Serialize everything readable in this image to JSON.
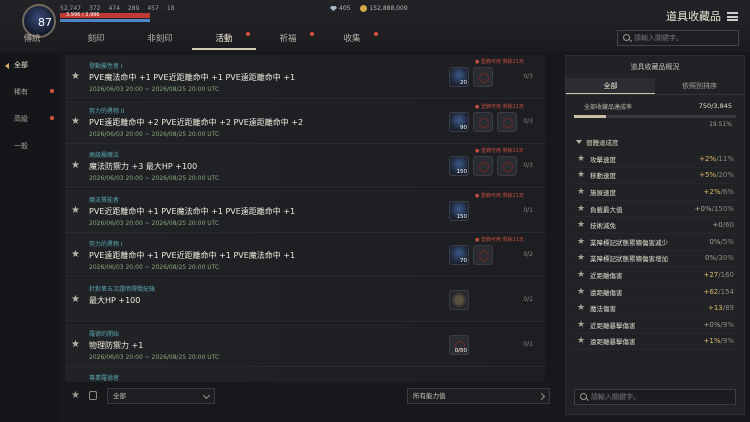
{
  "player": {
    "level": "87",
    "stats": [
      "52,747",
      "372",
      "474",
      "289",
      "457",
      "18"
    ],
    "hp_text": "3,996 / 3,996",
    "hp_fraction": 1.0,
    "mp_fraction": 1.0
  },
  "currency": {
    "gems": "405",
    "coins": "152,888,009"
  },
  "page_title": "道具收藏品",
  "tabs": [
    {
      "label": "傳統",
      "dot": false,
      "active": false
    },
    {
      "label": "刻印",
      "dot": false,
      "active": false
    },
    {
      "label": "非刻印",
      "dot": false,
      "active": false
    },
    {
      "label": "活動",
      "dot": true,
      "active": true
    },
    {
      "label": "祈福",
      "dot": true,
      "active": false
    },
    {
      "label": "收集",
      "dot": true,
      "active": false
    }
  ],
  "top_search": {
    "placeholder": "請輸入關鍵字。"
  },
  "sidebar": {
    "items": [
      {
        "label": "全部",
        "active": true,
        "dot": false
      },
      {
        "label": "稀有",
        "active": false,
        "dot": true
      },
      {
        "label": "高級",
        "active": false,
        "dot": true
      },
      {
        "label": "一般",
        "active": false,
        "dot": false
      }
    ]
  },
  "cards": [
    {
      "category": "發動屬性者 I",
      "title": "PVE魔法命中 +1  PVE近距離命中 +1  PVE遠距離命中 +1",
      "date": "2026/06/03 20:00 ~ 2026/08/25 20:00 UTC",
      "warn": "● 登錄可用 剩餘21天",
      "slots": [
        {
          "type": "filled",
          "n": "20"
        },
        {
          "type": "empty",
          "n": ""
        }
      ],
      "progress": "0/3"
    },
    {
      "category": "努力的勇物 II",
      "title": "PVE遠距離命中 +2  PVE近距離命中 +2  PVE遠距離命中 +2",
      "date": "2026/06/03 20:00 ~ 2026/08/25 20:00 UTC",
      "warn": "● 登錄可用 剩餘21天",
      "slots": [
        {
          "type": "filled",
          "n": "90"
        },
        {
          "type": "empty",
          "n": ""
        },
        {
          "type": "empty",
          "n": ""
        }
      ],
      "progress": "0/3"
    },
    {
      "category": "高級屬魔法",
      "title": "魔法防禦力 +3  最大HP +100",
      "date": "2026/06/03 20:00 ~ 2026/08/25 20:00 UTC",
      "warn": "● 登錄可用 剩餘21天",
      "slots": [
        {
          "type": "filled",
          "n": "150"
        },
        {
          "type": "empty",
          "n": ""
        },
        {
          "type": "empty",
          "n": ""
        }
      ],
      "progress": "0/3"
    },
    {
      "category": "魔法賢能者",
      "title": "PVE近距離命中 +1  PVE魔法命中 +1  PVE遠距離命中 +1",
      "date": "2026/06/03 20:00 ~ 2026/08/25 20:00 UTC",
      "warn": "● 登錄可用 剩餘21天",
      "slots": [
        {
          "type": "filled",
          "n": "150"
        }
      ],
      "progress": "0/1"
    },
    {
      "category": "努力的勇物 I",
      "title": "PVE遠距離命中 +1  PVE近距離命中 +1  PVE魔法命中 +1",
      "date": "2026/06/03 20:00 ~ 2026/08/25 20:00 UTC",
      "warn": "● 登錄可用 剩餘21天",
      "slots": [
        {
          "type": "filled",
          "n": "70"
        },
        {
          "type": "empty",
          "n": ""
        }
      ],
      "progress": "0/2"
    },
    {
      "category": "針對第五次證明得獎紀錄",
      "title": "最大HP +100",
      "date": "",
      "warn": "",
      "slots": [
        {
          "type": "ring",
          "n": ""
        }
      ],
      "progress": "0/1"
    },
    {
      "category": "羅德的開始",
      "title": "物理防禦力 +1",
      "date": "2026/06/03 20:00 ~ 2026/08/25 20:00 UTC",
      "warn": "",
      "slots": [
        {
          "type": "empty",
          "n": "0/50"
        }
      ],
      "progress": "0/1"
    },
    {
      "category": "專業羅德者",
      "title": "",
      "date": "",
      "warn": "",
      "slots": [],
      "progress": ""
    }
  ],
  "bottom": {
    "filter_label": "全部",
    "power_label": "所有能力值"
  },
  "panel": {
    "title": "道具收藏品概況",
    "tabs": [
      {
        "label": "全部",
        "active": true
      },
      {
        "label": "依照別排序",
        "active": false
      }
    ],
    "rate_label": "全部收藏品達成率",
    "rate_value": "750/3,845",
    "rate_fraction": 0.1951,
    "rate_percent": "19.51%",
    "section_label": "個體達成度",
    "stats": [
      {
        "name": "攻擊速度",
        "cur": "+2%",
        "max": "/11%",
        "zero": false
      },
      {
        "name": "移動速度",
        "cur": "+5%",
        "max": "/20%",
        "zero": false
      },
      {
        "name": "施展速度",
        "cur": "+2%",
        "max": "/6%",
        "zero": false
      },
      {
        "name": "負載最大值",
        "cur": "+0%",
        "max": "/150%",
        "zero": true
      },
      {
        "name": "技術減免",
        "cur": "+0",
        "max": "/60",
        "zero": true
      },
      {
        "name": "業障標記狀態累積傷害減少",
        "cur": "0%",
        "max": "/5%",
        "zero": true
      },
      {
        "name": "業障標記狀態累積傷害增加",
        "cur": "0%",
        "max": "/30%",
        "zero": true
      },
      {
        "name": "近距離傷害",
        "cur": "+27",
        "max": "/160",
        "zero": false
      },
      {
        "name": "遠距離傷害",
        "cur": "+62",
        "max": "/154",
        "zero": false
      },
      {
        "name": "魔法傷害",
        "cur": "+13",
        "max": "/89",
        "zero": false
      },
      {
        "name": "近距離暴擊傷害",
        "cur": "+0%",
        "max": "/9%",
        "zero": true
      },
      {
        "name": "遠距離暴擊傷害",
        "cur": "+1%",
        "max": "/9%",
        "zero": false
      }
    ],
    "search_placeholder": "請輸入關鍵字。"
  },
  "colors": {
    "accent_gold": "#d9bb68",
    "category_teal": "#5aa6ae",
    "date_green": "#88a77a",
    "alert_red": "#d9553f"
  },
  "icons": [
    "gem-icon",
    "coin-icon",
    "menu-icon",
    "search-icon",
    "star-icon",
    "lock-icon",
    "chevron-down-icon",
    "chevron-right-icon"
  ]
}
